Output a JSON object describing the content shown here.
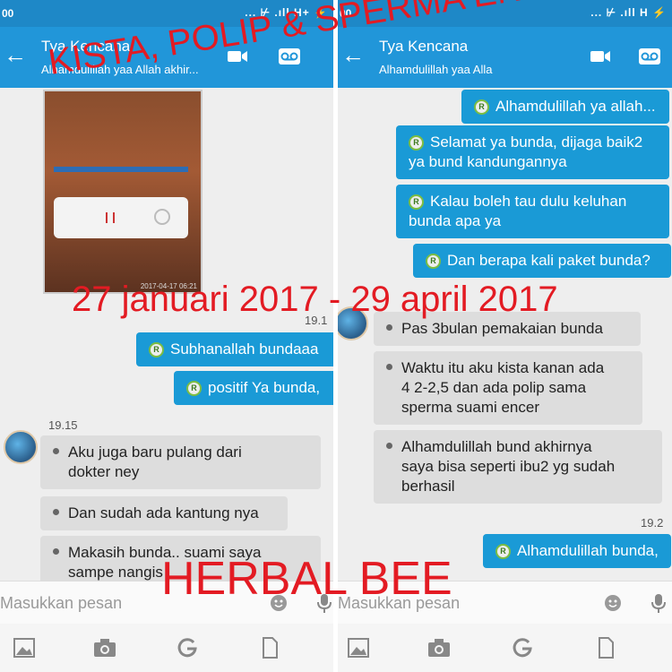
{
  "left_phone": {
    "status": {
      "left": "00",
      "right": "... ⊬ .ıll H+ ⚡"
    },
    "contact_name": "Tya Kencana",
    "contact_status": "Alhamdulillah yaa Allah akhir...",
    "photo_caption": "2017-04-17 06:21",
    "time_top": "19.1",
    "outgoing": [
      "Subhanallah bundaaa",
      "positif Ya bunda,"
    ],
    "time_mid": "19.15",
    "incoming": [
      {
        "l1": "Aku juga baru pulang dari",
        "l2": "dokter ney"
      },
      {
        "l1": "Dan sudah ada kantung nya",
        "l2": ""
      },
      {
        "l1": "Makasih bunda.. suami saya",
        "l2": "sampe nangis"
      }
    ],
    "input_placeholder": "Masukkan pesan"
  },
  "right_phone": {
    "status": {
      "left": "00",
      "right": "... ⊬ .ıll H ⚡"
    },
    "contact_name": "Tya Kencana",
    "contact_status": "Alhamdulillah yaa Alla",
    "outgoing": [
      {
        "l1": "Alhamdulillah ya allah...",
        "l2": ""
      },
      {
        "l1": "Selamat ya bunda, dijaga baik2",
        "l2": "ya bund kandungannya"
      },
      {
        "l1": "Kalau boleh tau dulu keluhan",
        "l2": "bunda apa ya"
      },
      {
        "l1": "Dan berapa kali paket bunda?",
        "l2": ""
      }
    ],
    "incoming": [
      {
        "l1": "Pas 3bulan pemakaian bunda",
        "l2": "",
        "l3": ""
      },
      {
        "l1": "Waktu itu aku kista kanan ada",
        "l2": "4 2-2,5 dan ada polip sama",
        "l3": "sperma suami encer"
      },
      {
        "l1": "Alhamdulillah bund akhirnya",
        "l2": "saya bisa seperti ibu2 yg sudah",
        "l3": "berhasil"
      }
    ],
    "time_bottom": "19.2",
    "last_outgoing": "Alhamdulillah bunda,",
    "input_placeholder": "Masukkan pesan"
  },
  "badge_letter": "R",
  "overlay": {
    "title": "KISTA, POLIP & SPERMA ENCER",
    "dates": "27 januari 2017 - 29 april 2017",
    "brand": "HERBAL BEE"
  },
  "colors": {
    "appbar": "#2196d9",
    "outgoing_bubble": "#1a9ad6",
    "incoming_bubble": "#dddddd",
    "overlay_text": "#e31b23"
  },
  "icons": [
    "back-arrow-icon",
    "video-call-icon",
    "voicemail-icon",
    "emoji-icon",
    "microphone-icon",
    "gallery-icon",
    "camera-icon",
    "gif-icon",
    "document-icon"
  ]
}
